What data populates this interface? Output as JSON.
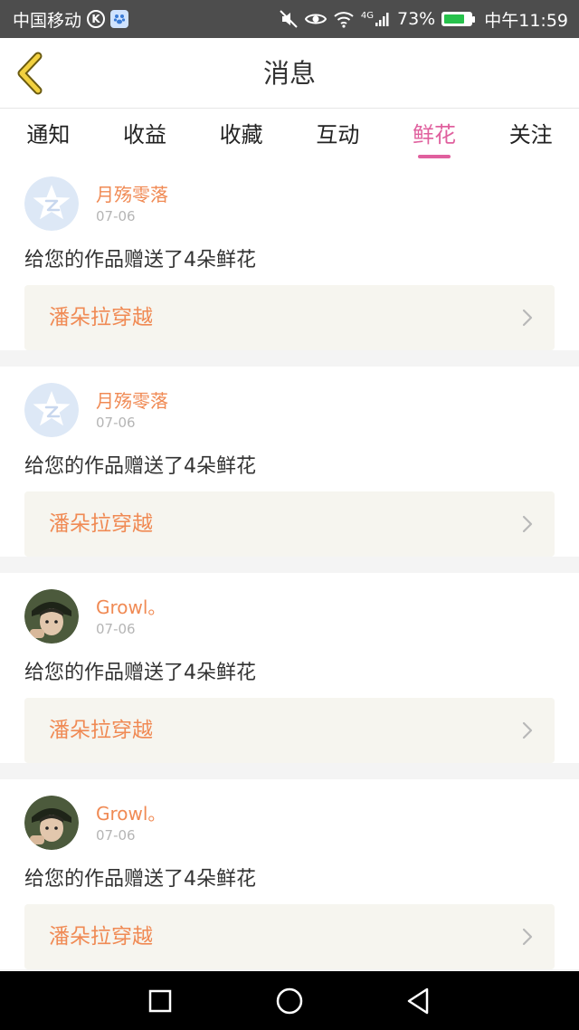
{
  "status_bar": {
    "carrier": "中国移动",
    "network": "4G",
    "battery_percent": "73%",
    "battery_level": 0.73,
    "time": "中午11:59"
  },
  "header": {
    "title": "消息",
    "back_icon": "back-chevron-icon"
  },
  "tabs": [
    {
      "label": "通知",
      "active": false
    },
    {
      "label": "收益",
      "active": false
    },
    {
      "label": "收藏",
      "active": false
    },
    {
      "label": "互动",
      "active": false
    },
    {
      "label": "鲜花",
      "active": true
    },
    {
      "label": "关注",
      "active": false
    }
  ],
  "colors": {
    "accent": "#e0609e",
    "username": "#f08a54",
    "work_bg": "#f6f5ef"
  },
  "notifications": [
    {
      "user": "月殇零落",
      "date": "07-06",
      "message": "给您的作品赠送了4朵鲜花",
      "work": "潘朵拉穿越",
      "avatar": "default-avatar-icon"
    },
    {
      "user": "月殇零落",
      "date": "07-06",
      "message": "给您的作品赠送了4朵鲜花",
      "work": "潘朵拉穿越",
      "avatar": "default-avatar-icon"
    },
    {
      "user": "Growl。",
      "date": "07-06",
      "message": "给您的作品赠送了4朵鲜花",
      "work": "潘朵拉穿越",
      "avatar": "photo-avatar"
    },
    {
      "user": "Growl。",
      "date": "07-06",
      "message": "给您的作品赠送了4朵鲜花",
      "work": "潘朵拉穿越",
      "avatar": "photo-avatar"
    }
  ]
}
